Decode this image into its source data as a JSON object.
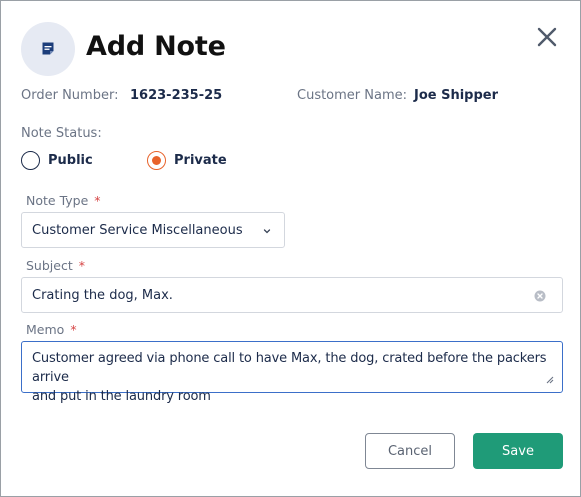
{
  "dialog": {
    "title": "Add Note",
    "icon": "note-icon",
    "close_icon": "close-icon"
  },
  "order": {
    "label": "Order Number:",
    "value": "1623-235-25"
  },
  "customer": {
    "label": "Customer Name:",
    "value": "Joe Shipper"
  },
  "status": {
    "label": "Note Status:",
    "options": [
      {
        "label": "Public",
        "checked": false
      },
      {
        "label": "Private",
        "checked": true
      }
    ]
  },
  "note_type": {
    "label": "Note Type",
    "required_mark": "*",
    "value": "Customer Service Miscellaneous"
  },
  "subject": {
    "label": "Subject",
    "required_mark": "*",
    "value": "Crating the dog, Max."
  },
  "memo": {
    "label": "Memo",
    "required_mark": "*",
    "line1": "Customer agreed via phone call to have Max, the dog, crated before the packers arrive",
    "line2": "and put in the laundry room"
  },
  "buttons": {
    "cancel": "Cancel",
    "save": "Save"
  },
  "colors": {
    "accent": "#e8632b",
    "save": "#1f9b78",
    "focus": "#3b6fc9",
    "icon_bg": "#e6eaf3"
  }
}
